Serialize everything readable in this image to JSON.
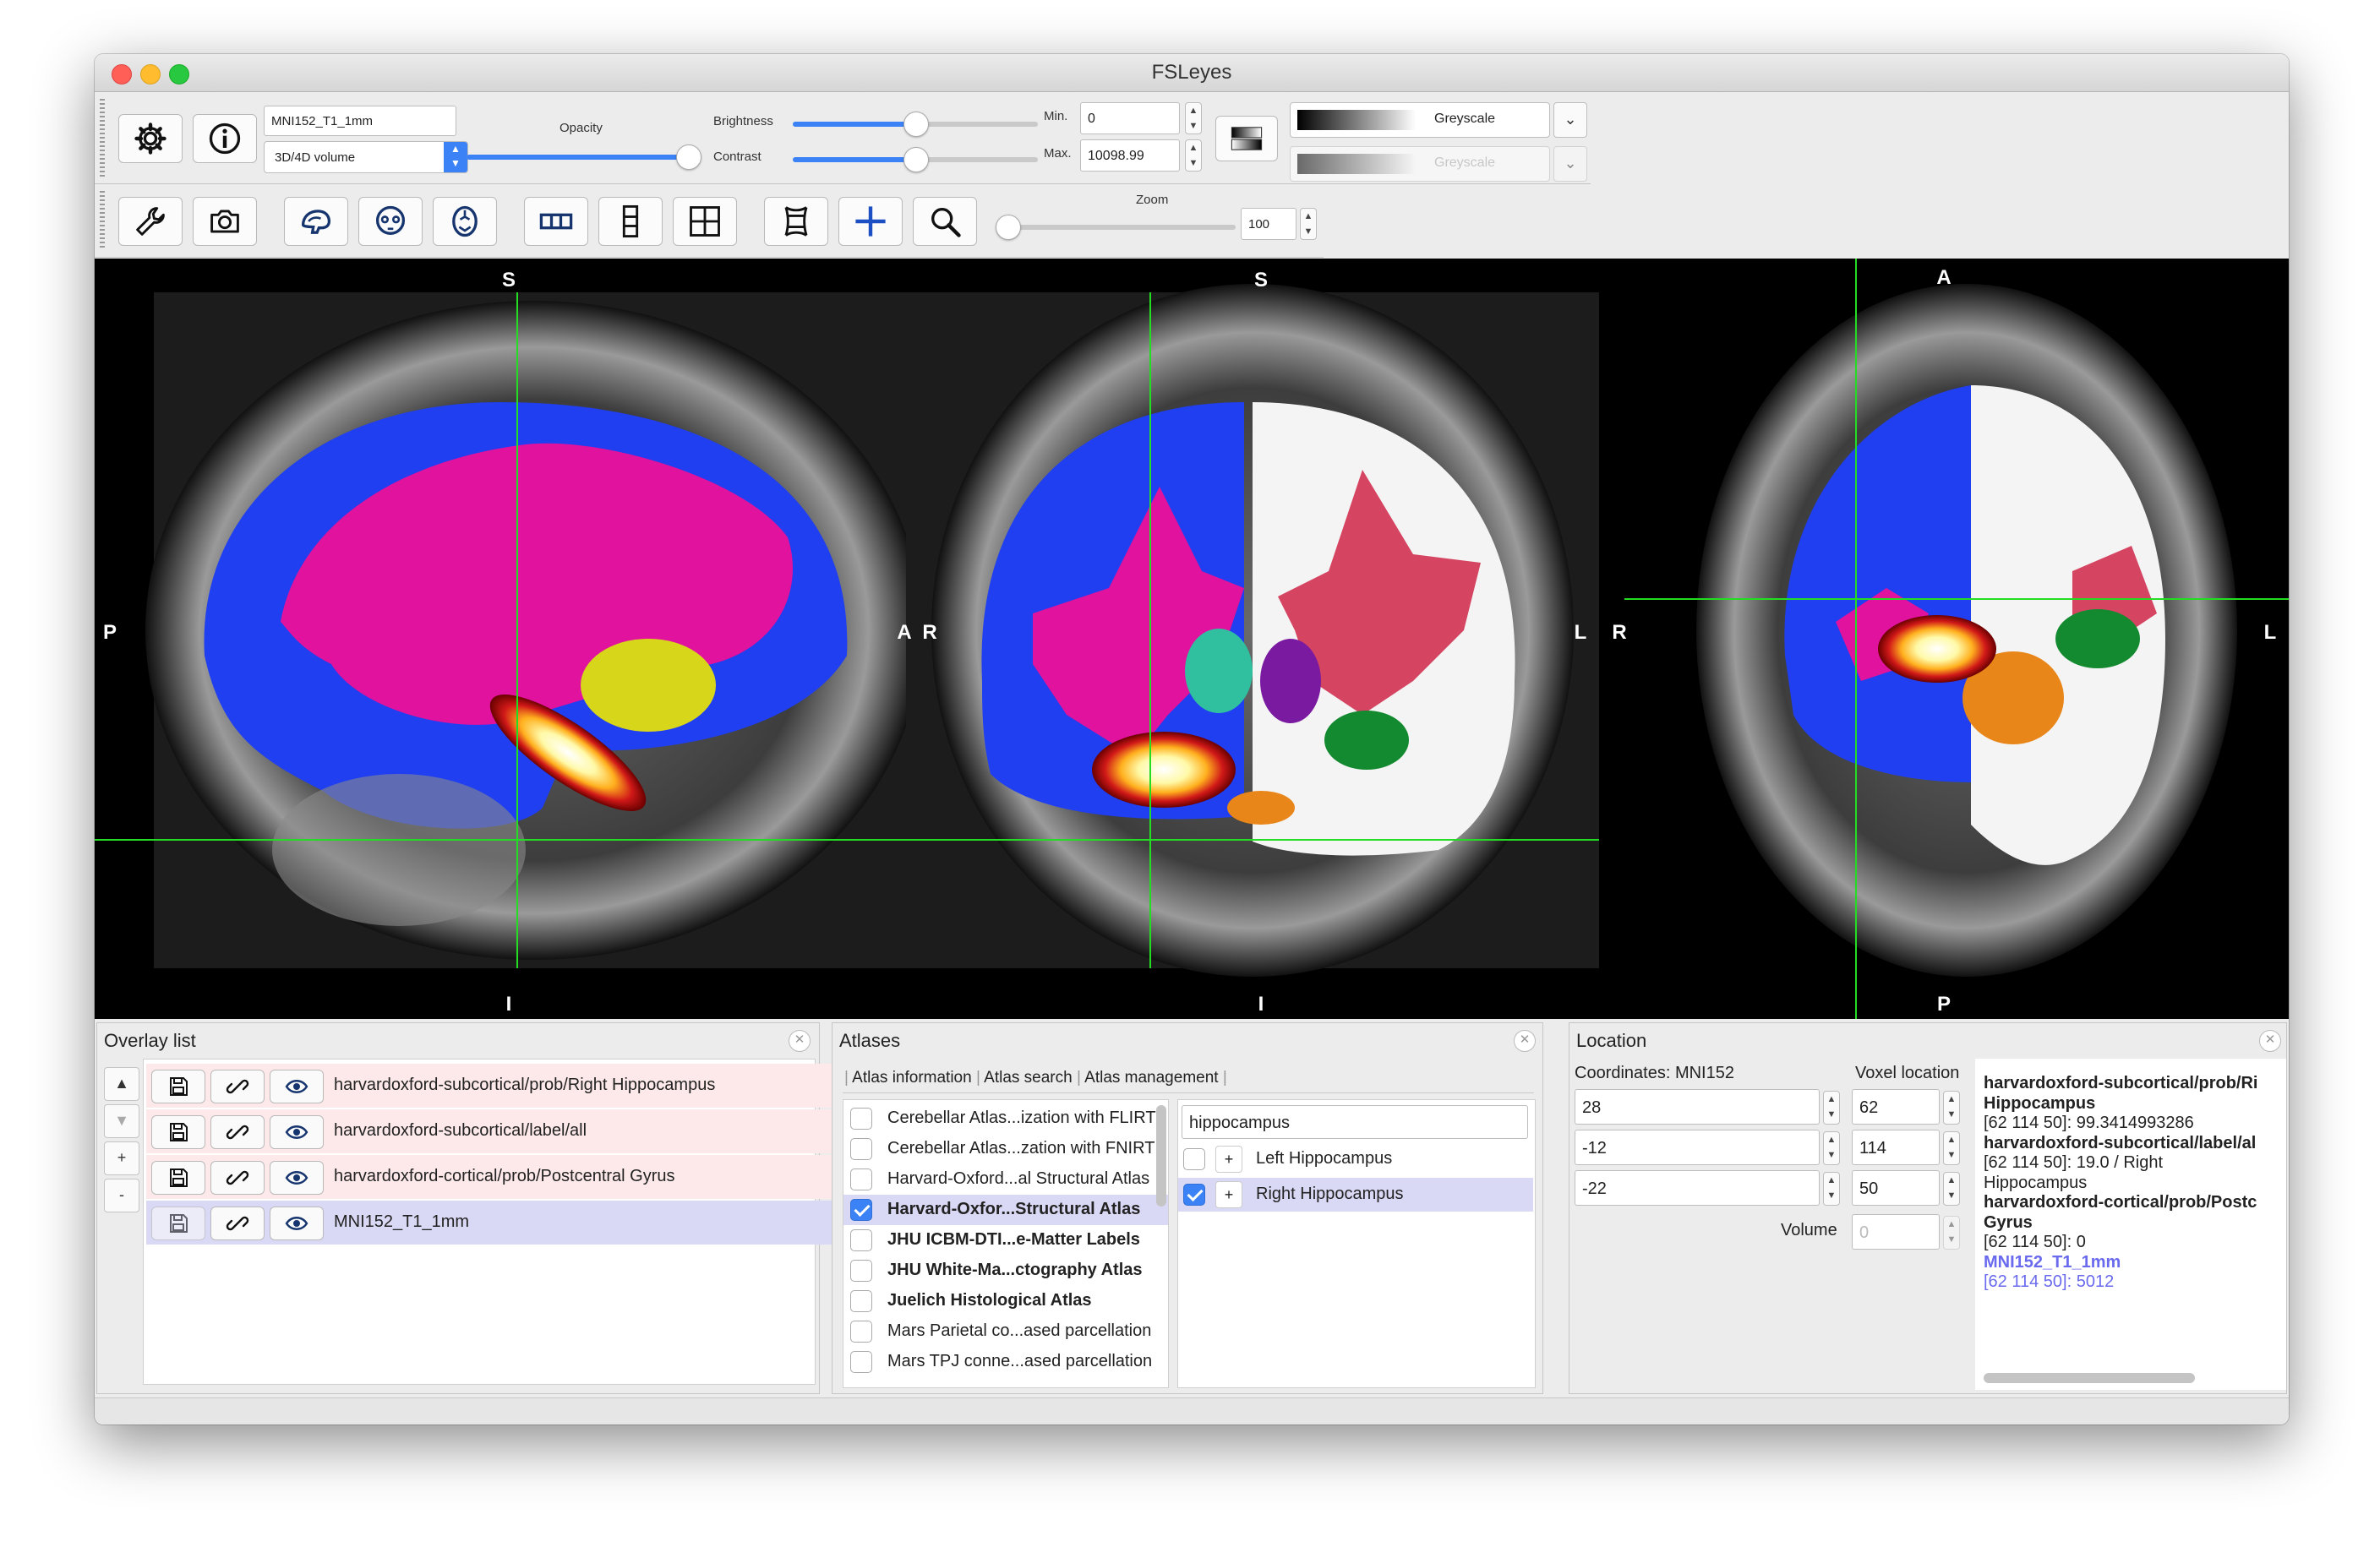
{
  "window": {
    "title": "FSLeyes"
  },
  "toolbar1": {
    "overlay_name": "MNI152_T1_1mm",
    "overlay_type": "3D/4D volume",
    "opacity_label": "Opacity",
    "opacity_value": 0.97,
    "brightness_label": "Brightness",
    "brightness_value": 0.5,
    "contrast_label": "Contrast",
    "contrast_value": 0.5,
    "min_label": "Min.",
    "min_value": "0",
    "max_label": "Max.",
    "max_value": "10098.99",
    "colormap1": "Greyscale",
    "colormap2": "Greyscale"
  },
  "toolbar2": {
    "zoom_label": "Zoom",
    "zoom_value": "100",
    "icons": [
      "wrench-icon",
      "camera-icon",
      "sagittal-brain-icon",
      "coronal-brain-icon",
      "axial-brain-icon",
      "horizontal-layout-icon",
      "vertical-layout-icon",
      "grid-layout-icon",
      "movie-icon",
      "crosshair-icon",
      "zoom-icon"
    ]
  },
  "views": {
    "sagittal": {
      "top": "S",
      "bottom": "I",
      "left": "P",
      "right": "A"
    },
    "coronal": {
      "top": "S",
      "bottom": "I",
      "left": "R",
      "right": "L"
    },
    "axial": {
      "top": "A",
      "bottom": "P",
      "left": "R",
      "right": "L"
    },
    "colors": {
      "crosshair": "#22dd22",
      "wm_left": "#1f3ff0",
      "gm_left": "#e0129e",
      "cortex_right": "#f4f4f4",
      "wm_right": "#d54562"
    }
  },
  "overlay_list": {
    "title": "Overlay list",
    "items": [
      {
        "name": "harvardoxford-subcortical/prob/Right Hippocampus"
      },
      {
        "name": "harvardoxford-subcortical/label/all"
      },
      {
        "name": "harvardoxford-cortical/prob/Postcentral Gyrus"
      },
      {
        "name": "MNI152_T1_1mm"
      }
    ],
    "side_buttons": [
      "▲",
      "▼",
      "+",
      "-"
    ]
  },
  "atlases": {
    "title": "Atlases",
    "tabs": [
      "Atlas information",
      "Atlas search",
      "Atlas management"
    ],
    "items": [
      {
        "name": "Cerebellar Atlas...ization with FLIRT",
        "checked": false,
        "bold": false
      },
      {
        "name": "Cerebellar Atlas...zation with FNIRT",
        "checked": false,
        "bold": false
      },
      {
        "name": "Harvard-Oxford...al Structural Atlas",
        "checked": false,
        "bold": false
      },
      {
        "name": "Harvard-Oxfor...Structural Atlas",
        "checked": true,
        "bold": true
      },
      {
        "name": "JHU ICBM-DTI...e-Matter Labels",
        "checked": false,
        "bold": true
      },
      {
        "name": "JHU White-Ma...ctography Atlas",
        "checked": false,
        "bold": true
      },
      {
        "name": "Juelich Histological Atlas",
        "checked": false,
        "bold": true
      },
      {
        "name": "Mars Parietal co...ased parcellation",
        "checked": false,
        "bold": false
      },
      {
        "name": "Mars TPJ conne...ased parcellation",
        "checked": false,
        "bold": false
      }
    ],
    "search_value": "hippocampus",
    "results": [
      {
        "name": "Left Hippocampus",
        "checked": false
      },
      {
        "name": "Right Hippocampus",
        "checked": true
      }
    ]
  },
  "location": {
    "title": "Location",
    "coords_label": "Coordinates: MNI152",
    "voxel_label": "Voxel location",
    "coords": [
      "28",
      "-12",
      "-22"
    ],
    "voxels": [
      "62",
      "114",
      "50"
    ],
    "volume_label": "Volume",
    "volume_value": "0",
    "info": [
      "harvardoxford-subcortical/prob/Ri",
      "Hippocampus",
      "[62 114 50]: 99.3414993286",
      "harvardoxford-subcortical/label/al",
      "[62 114 50]: 19.0 / Right",
      "Hippocampus",
      "harvardoxford-cortical/prob/Postc",
      "Gyrus",
      "[62 114 50]: 0",
      "MNI152_T1_1mm",
      "[62 114 50]: 5012"
    ]
  }
}
